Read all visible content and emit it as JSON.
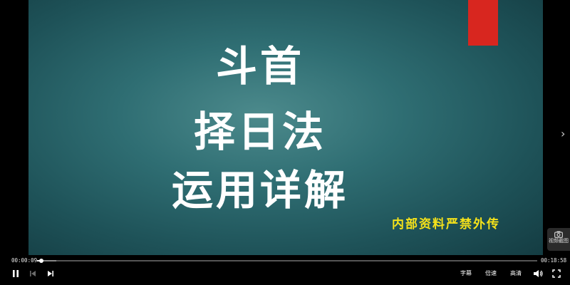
{
  "slide": {
    "title_lines": [
      "斗首",
      "择日法",
      "运用详解"
    ],
    "watermark": "内部资料严禁外传",
    "colors": {
      "background": "#2f6e73",
      "title": "#ffffff",
      "watermark": "#f5e21a",
      "accent_rect": "#d8261f"
    }
  },
  "side": {
    "next_icon": "chevron-right-icon",
    "next_glyph": "›",
    "screenshot_label": "视频截图",
    "screenshot_icon": "camera-icon"
  },
  "controls": {
    "current_time": "00:00:09",
    "total_time": "00:18:58",
    "progress": 0.008,
    "buffered": 0.038,
    "play_pause_icon": "pause-icon",
    "previous_icon": "skip-previous-icon",
    "next_icon": "skip-next-icon",
    "subtitle_label": "字幕",
    "speed_label": "倍速",
    "quality_label": "高清",
    "volume_icon": "volume-icon",
    "fullscreen_icon": "fullscreen-icon"
  }
}
